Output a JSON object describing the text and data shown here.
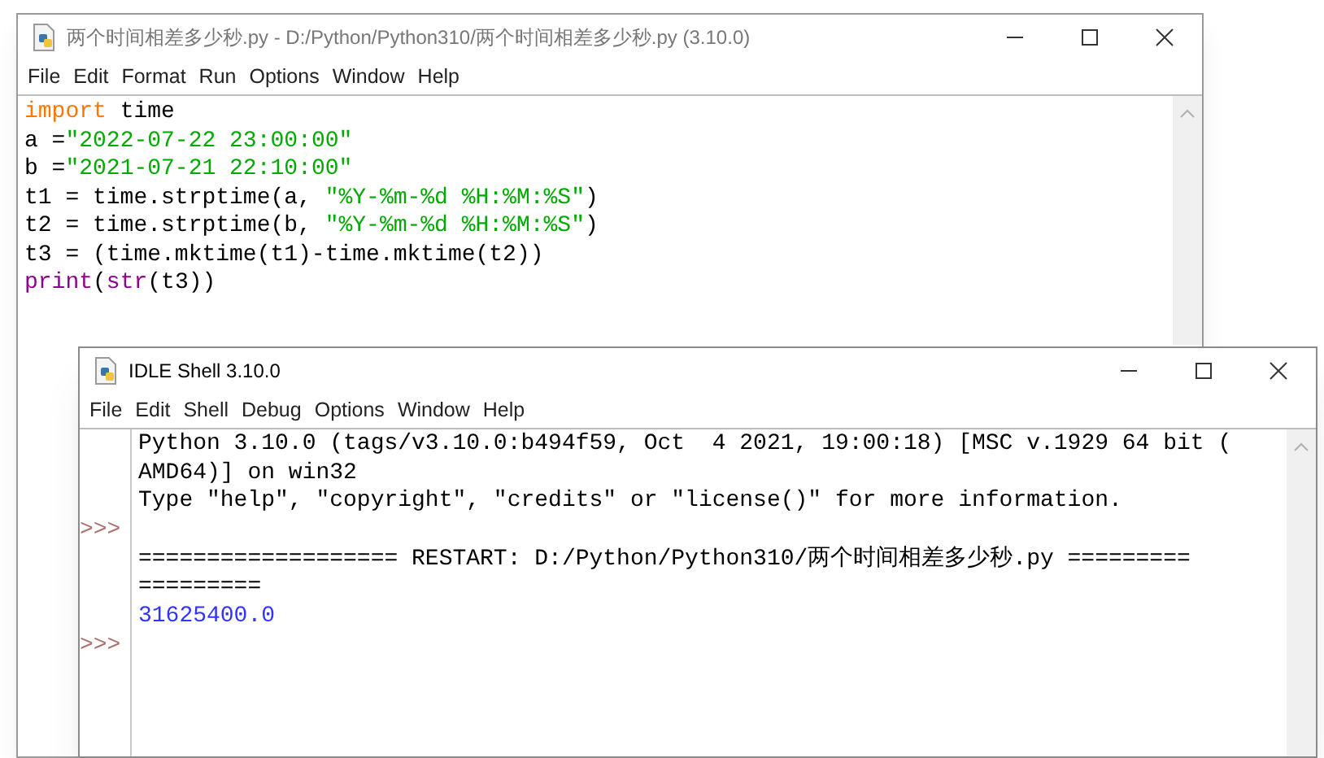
{
  "editor": {
    "title": "两个时间相差多少秒.py - D:/Python/Python310/两个时间相差多少秒.py (3.10.0)",
    "active": false,
    "menu": [
      "File",
      "Edit",
      "Format",
      "Run",
      "Options",
      "Window",
      "Help"
    ],
    "code": [
      [
        {
          "text": "import",
          "kind": "keyword"
        },
        {
          "text": " time",
          "kind": "plain"
        }
      ],
      [
        {
          "text": "a =",
          "kind": "plain"
        },
        {
          "text": "\"2022-07-22 23:00:00\"",
          "kind": "string"
        }
      ],
      [
        {
          "text": "b =",
          "kind": "plain"
        },
        {
          "text": "\"2021-07-21 22:10:00\"",
          "kind": "string"
        }
      ],
      [
        {
          "text": "t1 = time.strptime(a, ",
          "kind": "plain"
        },
        {
          "text": "\"%Y-%m-%d %H:%M:%S\"",
          "kind": "string"
        },
        {
          "text": ")",
          "kind": "plain"
        }
      ],
      [
        {
          "text": "t2 = time.strptime(b, ",
          "kind": "plain"
        },
        {
          "text": "\"%Y-%m-%d %H:%M:%S\"",
          "kind": "string"
        },
        {
          "text": ")",
          "kind": "plain"
        }
      ],
      [
        {
          "text": "t3 = (time.mktime(t1)-time.mktime(t2))",
          "kind": "plain"
        }
      ],
      [
        {
          "text": "print",
          "kind": "builtin"
        },
        {
          "text": "(",
          "kind": "plain"
        },
        {
          "text": "str",
          "kind": "builtin"
        },
        {
          "text": "(t3))",
          "kind": "plain"
        }
      ]
    ]
  },
  "shell": {
    "title": "IDLE Shell 3.10.0",
    "active": true,
    "menu": [
      "File",
      "Edit",
      "Shell",
      "Debug",
      "Options",
      "Window",
      "Help"
    ],
    "lines": [
      {
        "text": "Python 3.10.0 (tags/v3.10.0:b494f59, Oct  4 2021, 19:00:18) [MSC v.1929 64 bit (",
        "kind": "output"
      },
      {
        "text": "AMD64)] on win32",
        "kind": "output"
      },
      {
        "text": "Type \"help\", \"copyright\", \"credits\" or \"license()\" for more information.",
        "kind": "output"
      },
      {
        "prompt": ">>>"
      },
      {
        "text": "=================== RESTART: D:/Python/Python310/两个时间相差多少秒.py =========",
        "kind": "output"
      },
      {
        "text": "=========",
        "kind": "output"
      },
      {
        "text": "31625400.0",
        "kind": "stdout"
      },
      {
        "prompt": ">>>"
      }
    ]
  }
}
